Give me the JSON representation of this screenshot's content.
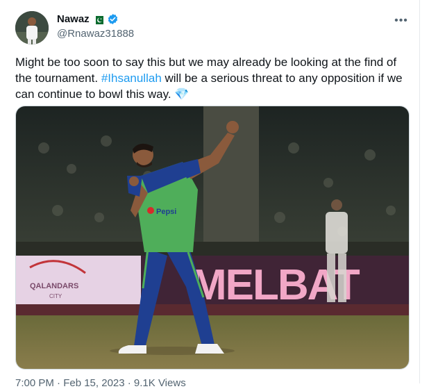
{
  "author": {
    "display_name": "Nawaz",
    "handle": "@Rnawaz31888",
    "flag_icon": "pakistan-flag-icon",
    "verified_icon": "verified-badge-icon"
  },
  "more_menu_label": "•••",
  "tweet": {
    "text_before": "Might be too soon to say this but we may already be looking at the find of the tournament. ",
    "hashtag": "#Ihsanullah",
    "text_after": " will be a serious threat to any opposition if we can continue to bowl this way.",
    "emoji": "💎"
  },
  "media": {
    "banner_left_text": "QALANDARS",
    "banner_left_subtext": "CITY",
    "banner_right_text": "MELBAT",
    "shirt_sponsor": "Pepsi"
  },
  "footer": {
    "timestamp": "7:00 PM · Feb 15, 2023 · 9.1K Views"
  },
  "colors": {
    "accent": "#1d9bf0",
    "text": "#0f1419",
    "muted": "#536471",
    "jersey_green": "#4fae5a",
    "jersey_blue": "#1f3f91",
    "banner_orange": "#f26a2a"
  }
}
